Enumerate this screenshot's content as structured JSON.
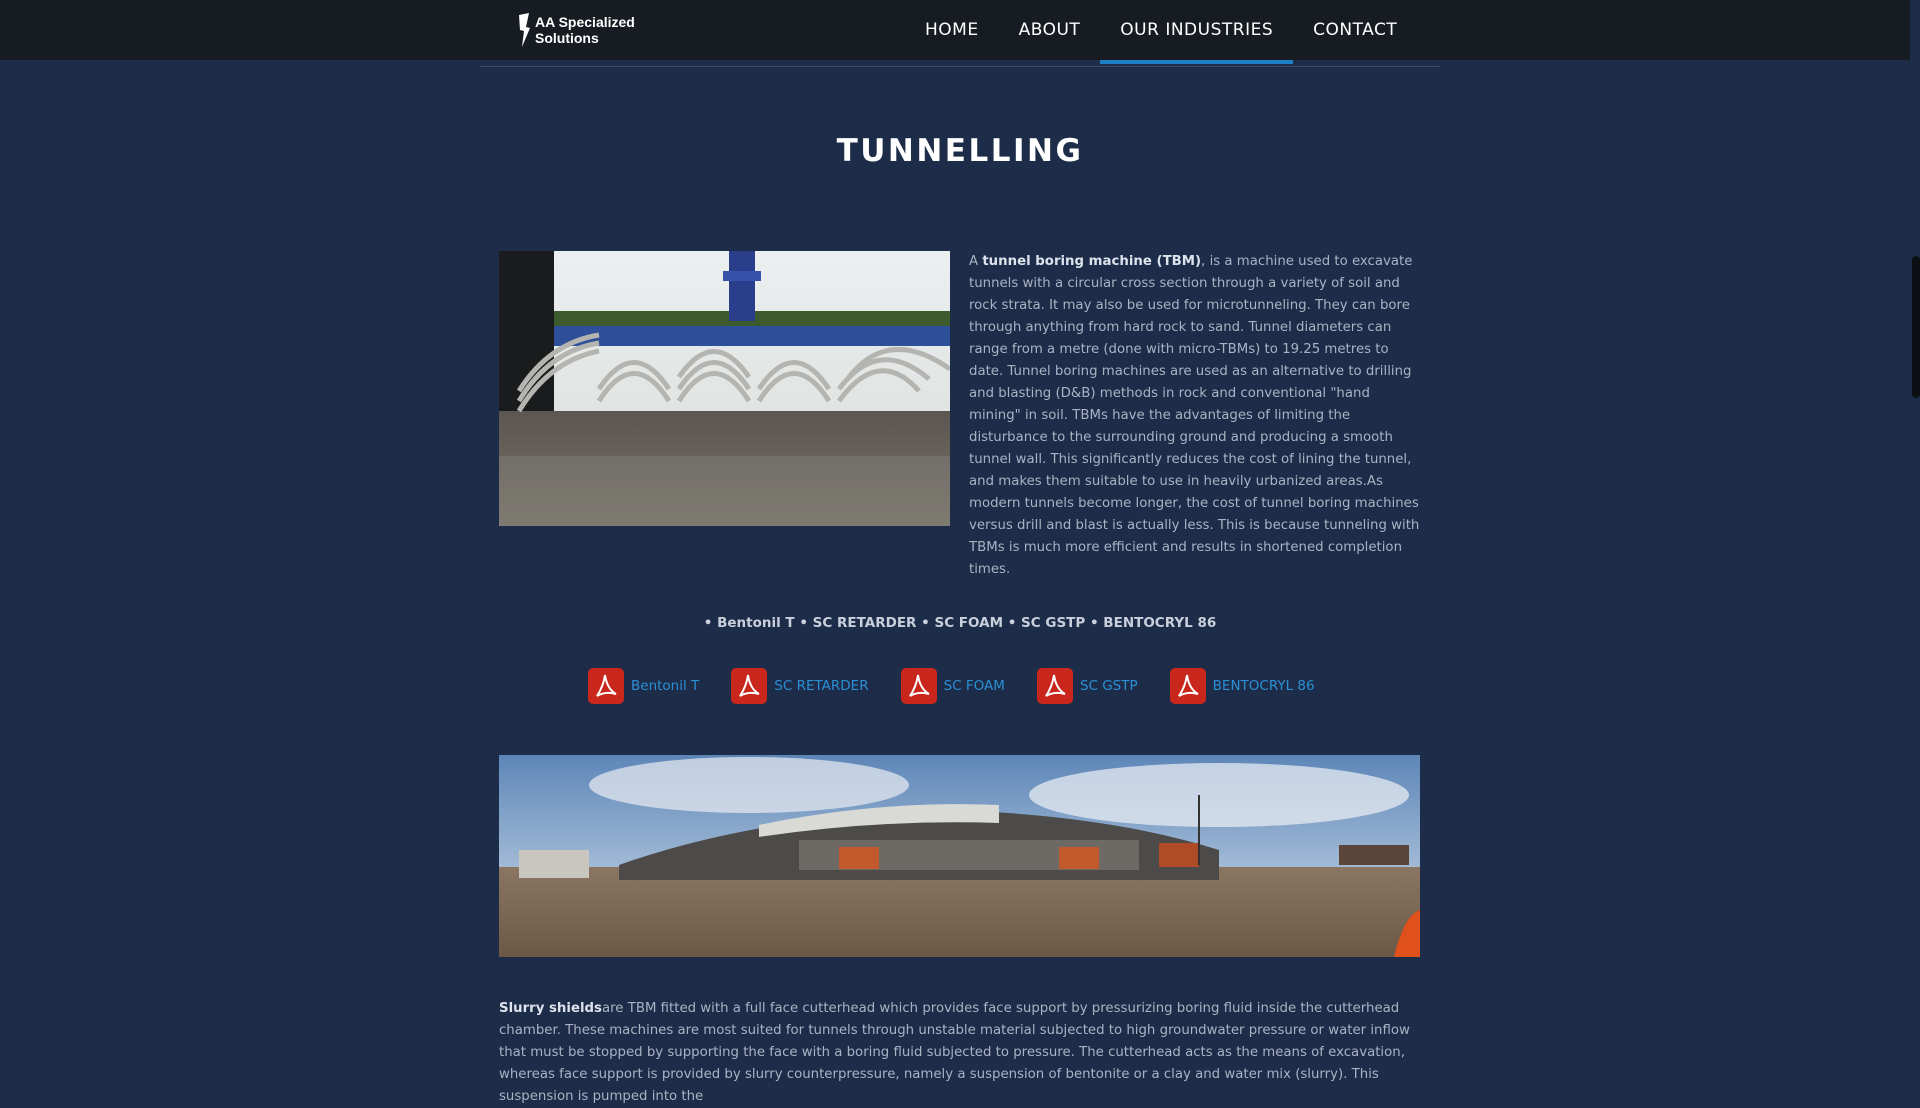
{
  "header": {
    "logo_text": "AA Specialized Solutions",
    "nav": [
      "HOME",
      "ABOUT",
      "OUR INDUSTRIES",
      "CONTACT"
    ],
    "active_nav": "OUR INDUSTRIES"
  },
  "page": {
    "title": "TUNNELLING",
    "intro": {
      "lead": "A ",
      "term": "tunnel boring machine (TBM)",
      "text": ", is a machine used to excavate tunnels with a circular cross section through a variety of soil and rock strata. It may also be used for microtunneling. They can bore through anything from hard rock to sand. Tunnel diameters can range from a metre (done with micro-TBMs) to 19.25 metres to date. Tunnel boring machines are used as an alternative to drilling and blasting (D&B) methods in rock and conventional \"hand mining\" in soil. TBMs have the advantages of limiting the disturbance to the surrounding ground and producing a smooth tunnel wall. This significantly reduces the cost of lining the tunnel, and makes them suitable to use in heavily urbanized areas.As modern tunnels become longer, the cost of tunnel boring machines versus drill and blast is actually less. This is because tunneling with TBMs is much more efficient and results in shortened completion times."
    },
    "product_line": "• Bentonil T • SC RETARDER • SC FOAM • SC GSTP • BENTOCRYL 86",
    "pdf_links": [
      "Bentonil T",
      "SC RETARDER",
      "SC FOAM",
      "SC GSTP",
      "BENTOCRYL 86"
    ],
    "slurry": {
      "term": "Slurry shields",
      "text": "are TBM fitted with a full face cutterhead which provides face support by pressurizing boring fluid inside the cutterhead chamber. These machines are most suited for tunnels through unstable material subjected to high groundwater pressure or water inflow that must be stopped by supporting the face with a boring fluid subjected to pressure. The cutterhead acts as the means of excavation, whereas face support is provided by slurry counterpressure, namely a suspension of bentonite or a clay and water mix (slurry). This suspension is pumped into the"
    }
  },
  "colors": {
    "page_bg": "#1d2c48",
    "nav_bg": "#171c22",
    "accent": "#1d7fc4",
    "link": "#2b8fd6",
    "pdf_red": "#c9271b"
  }
}
